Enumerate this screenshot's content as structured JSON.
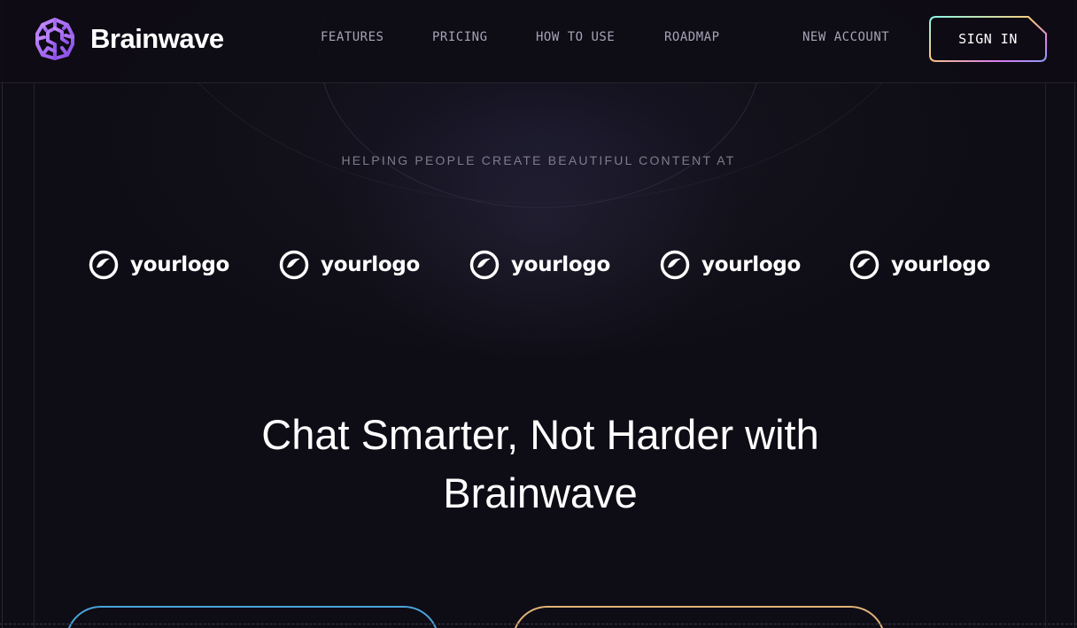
{
  "brand": {
    "name": "Brainwave",
    "logo_icon": "brain-maze-icon"
  },
  "nav": {
    "links": [
      "FEATURES",
      "PRICING",
      "HOW TO USE",
      "ROADMAP"
    ],
    "new_account": "NEW ACCOUNT",
    "sign_in": "SIGN IN"
  },
  "hero": {
    "tagline": "HELPING PEOPLE CREATE BEAUTIFUL CONTENT AT",
    "partner_logos": [
      "yourlogo",
      "yourlogo",
      "yourlogo",
      "yourlogo",
      "yourlogo"
    ],
    "title_line1": "Chat Smarter, Not Harder with",
    "title_line2": "Brainwave"
  },
  "colors": {
    "background": "#0e0c15",
    "brand_purple": "#ac6aff",
    "card_blue": "#4aa3d8",
    "card_gold": "#e0b378",
    "nav_text": "#a8a4b8"
  }
}
